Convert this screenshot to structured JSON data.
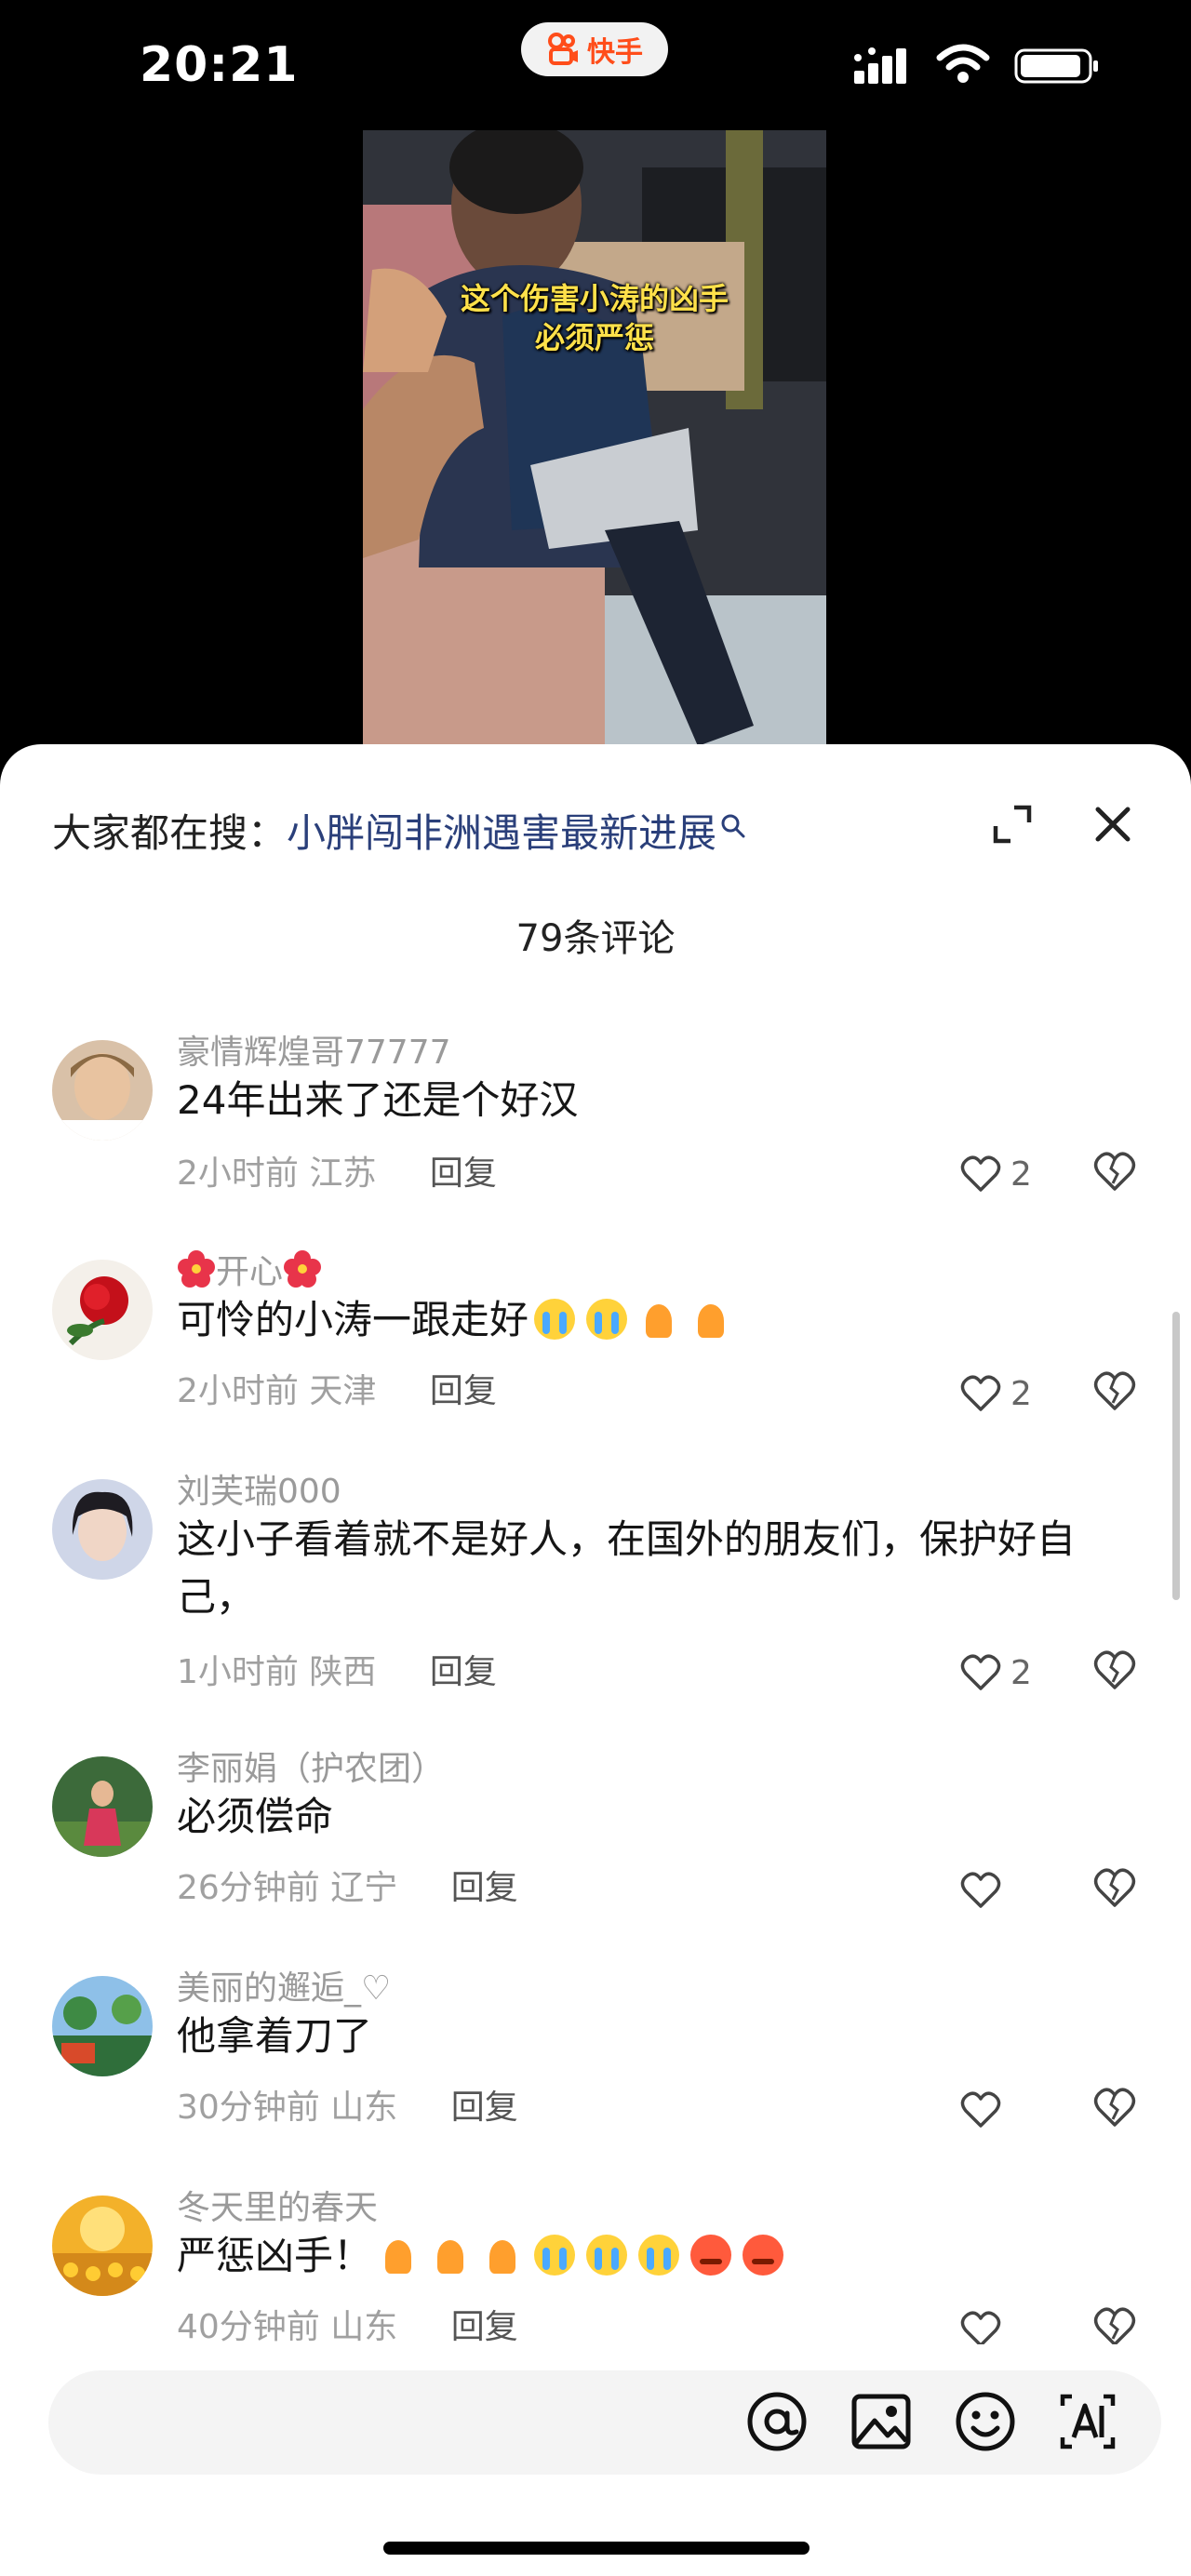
{
  "status_bar": {
    "time": "20:21",
    "app_name": "快手"
  },
  "video": {
    "caption_line1": "这个伤害小涛的凶手",
    "caption_line2": "必须严惩"
  },
  "sheet": {
    "search_prefix": "大家都在搜：",
    "search_term": "小胖闯非洲遇害最新进展",
    "comment_count": "79条评论"
  },
  "comments": [
    {
      "name": "豪情辉煌哥77777",
      "text": "24年出来了还是个好汉",
      "time": "2小时前",
      "location": "江苏",
      "reply": "回复",
      "likes": "2"
    },
    {
      "name": "开心",
      "text": "可怜的小涛一跟走好",
      "time": "2小时前",
      "location": "天津",
      "reply": "回复",
      "likes": "2"
    },
    {
      "name": "刘芙瑞000",
      "text": "这小子看着就不是好人，在国外的朋友们，保护好自己，",
      "time": "1小时前",
      "location": "陕西",
      "reply": "回复",
      "likes": "2"
    },
    {
      "name": "李丽娟（护农团）",
      "text": "必须偿命",
      "time": "26分钟前",
      "location": "辽宁",
      "reply": "回复",
      "likes": ""
    },
    {
      "name": "美丽的邂逅_♡",
      "text": "他拿着刀了",
      "time": "30分钟前",
      "location": "山东",
      "reply": "回复",
      "likes": ""
    },
    {
      "name": "冬天里的春天",
      "text": "严惩凶手！",
      "time": "40分钟前",
      "location": "山东",
      "reply": "回复",
      "likes": ""
    }
  ],
  "icons": {
    "expand": "expand-icon",
    "close": "close-icon",
    "like": "heart-icon",
    "dislike": "broken-heart-icon",
    "at": "at-icon",
    "image": "image-icon",
    "emoji": "emoji-icon",
    "ai": "ai-icon"
  },
  "colors": {
    "accent": "#ff4d1a",
    "search_term": "#2a3f7a",
    "caption": "#ffe14a"
  }
}
